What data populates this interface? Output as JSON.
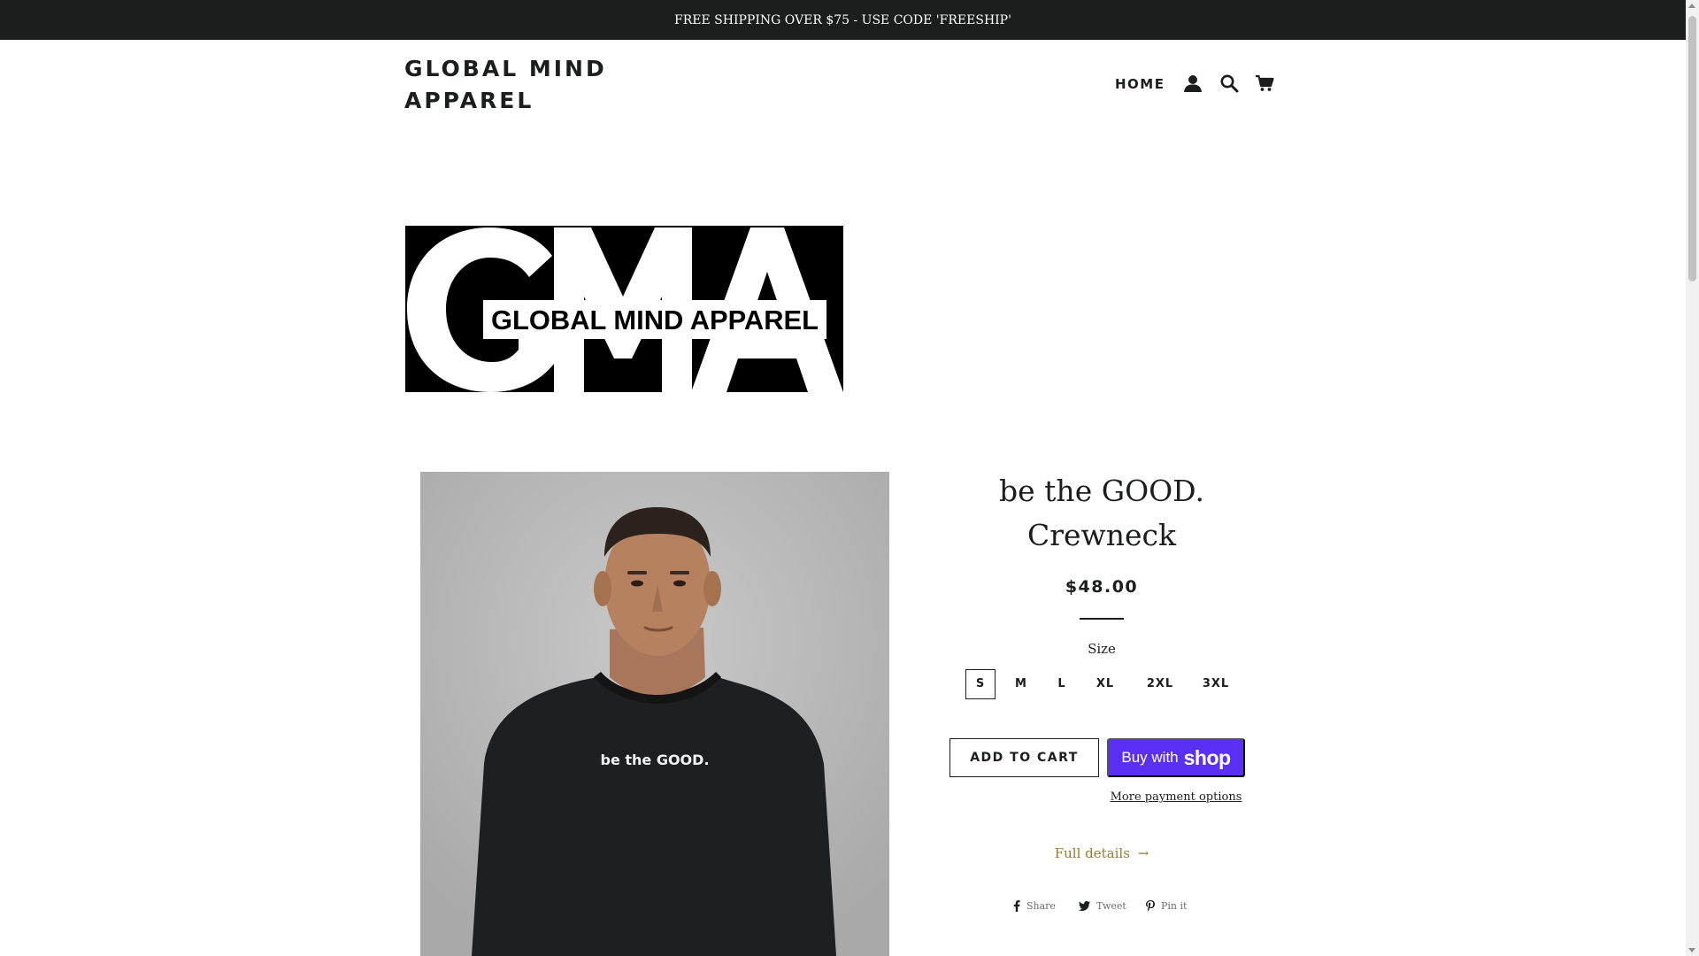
{
  "announcement": "FREE SHIPPING OVER $75 - USE CODE 'FREESHIP'",
  "header": {
    "brand_line1": "GLOBAL MIND",
    "brand_line2": "APPAREL",
    "nav": {
      "home": "HOME",
      "icons": [
        "account-icon",
        "search-icon",
        "cart-icon"
      ]
    }
  },
  "logo_banner": {
    "monogram": "GMA",
    "text": "GLOBAL MIND APPAREL"
  },
  "product": {
    "image_alt": "Model wearing black crewneck sweatshirt",
    "shirt_text": "be the GOOD.",
    "title_line1": "be the GOOD.",
    "title_line2": "Crewneck",
    "price": "$48.00",
    "size_label": "Size",
    "sizes": [
      "S",
      "M",
      "L",
      "XL",
      "2XL",
      "3XL"
    ],
    "selected_size": "S",
    "add_to_cart": "ADD TO CART",
    "buy_with": "Buy with",
    "shop_word": "shop",
    "more_payment": "More payment options",
    "full_details": "Full details",
    "full_details_arrow": "→",
    "share": {
      "facebook": "Share",
      "twitter": "Tweet",
      "pinterest": "Pin it"
    }
  },
  "colors": {
    "announcement_bg": "#1c1d1d",
    "text": "#1c1d1d",
    "shop_pay": "#5a31f4",
    "link_gold": "#9b7a2c"
  }
}
